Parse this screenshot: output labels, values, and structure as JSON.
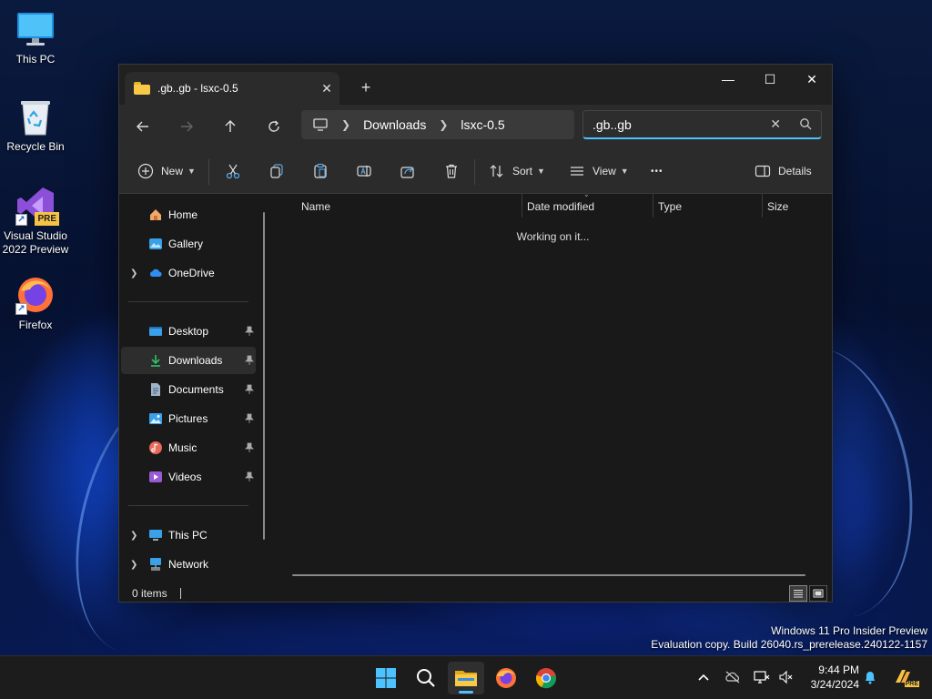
{
  "desktop": {
    "icons": [
      {
        "label": "This PC"
      },
      {
        "label": "Recycle Bin"
      },
      {
        "label": "Visual Studio 2022 Preview",
        "badge": "PRE"
      },
      {
        "label": "Firefox"
      }
    ]
  },
  "window": {
    "tab_title": ".gb..gb - lsxc-0.5",
    "tab_close": "✕",
    "new_tab": "+",
    "controls": {
      "minimize": "—",
      "maximize": "☐",
      "close": "✕"
    },
    "address": {
      "crumbs": [
        "Downloads",
        "lsxc-0.5"
      ]
    },
    "search": {
      "value": ".gb..gb",
      "clear": "✕"
    },
    "toolbar": {
      "new_label": "New",
      "sort_label": "Sort",
      "view_label": "View",
      "more_label": "•••",
      "details_label": "Details"
    },
    "sidebar": {
      "items": [
        {
          "label": "Home"
        },
        {
          "label": "Gallery"
        },
        {
          "label": "OneDrive"
        },
        {
          "label": "Desktop"
        },
        {
          "label": "Downloads"
        },
        {
          "label": "Documents"
        },
        {
          "label": "Pictures"
        },
        {
          "label": "Music"
        },
        {
          "label": "Videos"
        },
        {
          "label": "This PC"
        },
        {
          "label": "Network"
        }
      ]
    },
    "columns": [
      "Name",
      "Date modified",
      "Type",
      "Size"
    ],
    "status_message": "Working on it...",
    "statusbar": {
      "items_count": "0 items"
    }
  },
  "watermark": {
    "line1": "Windows 11 Pro Insider Preview",
    "line2": "Evaluation copy. Build 26040.rs_prerelease.240122-1157"
  },
  "taskbar": {
    "time": "9:44 PM",
    "date": "3/24/2024",
    "tray_badge": "PRE"
  },
  "colors": {
    "accent": "#4cc2ff",
    "folder": "#f7c946",
    "window_bg": "#191919",
    "toolbar_bg": "#2b2b2b"
  }
}
